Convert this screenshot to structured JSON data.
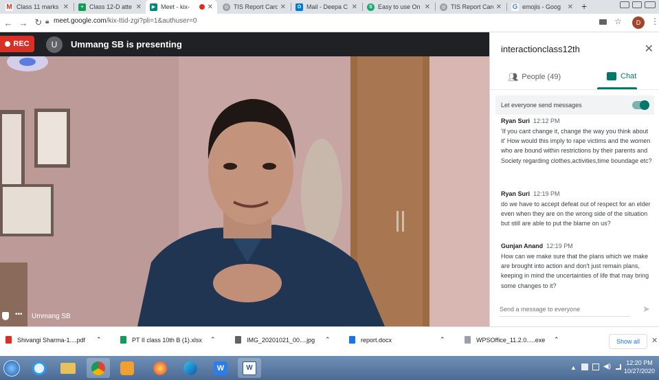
{
  "browser": {
    "tabs": [
      {
        "title": "Class 11 marks",
        "icon": "gmail-icon",
        "color": "#d93025"
      },
      {
        "title": "Class 12-D atte",
        "icon": "sheets-icon",
        "color": "#0f9d58"
      },
      {
        "title": "Meet - kix-",
        "icon": "meet-icon",
        "color": "#00897b",
        "active": true
      },
      {
        "title": "TIS Report Card",
        "icon": "globe-icon",
        "color": "#5f6368"
      },
      {
        "title": "Mail - Deepa C",
        "icon": "outlook-icon",
        "color": "#0078d4"
      },
      {
        "title": "Easy to use On",
        "icon": "s-icon",
        "color": "#1ba672"
      },
      {
        "title": "TIS Report Card",
        "icon": "globe-icon",
        "color": "#5f6368"
      },
      {
        "title": "emojis - Goog",
        "icon": "google-icon",
        "color": "#4285f4"
      }
    ],
    "new_tab": "+",
    "url_host": "meet.google.com",
    "url_path": "/kix-ttid-zgi?pli=1&authuser=0",
    "profile_letter": "D"
  },
  "meet": {
    "rec_label": "REC",
    "presenter_initial": "U",
    "presenting_text": "Ummang SB is presenting",
    "tile_name": "Ummang SB"
  },
  "panel": {
    "title": "interactionclass12th",
    "people_label": "People (49)",
    "chat_label": "Chat",
    "toggle_label": "Let everyone send messages",
    "messages": [
      {
        "author": "Ryan Suri",
        "time": "12:12 PM",
        "text": "'If you cant change it, change the way you think about it' How would this imply to rape victims and the women who are bound within restrictions by their parents and Society regarding clothes,activities,time boundage etc?"
      },
      {
        "author": "Ryan Suri",
        "time": "12:19 PM",
        "text": "do we have to accept defeat out of respect for an elder even when they are on the wrong side of the situation but still are able to put the blame on us?"
      },
      {
        "author": "Gunjan Anand",
        "time": "12:19 PM",
        "text": "How can we make sure that the plans which we make are brought into action and don't just remain plans, keeping in mind the uncertainties of life that may bring some changes to it?"
      }
    ],
    "compose_placeholder": "Send a message to everyone"
  },
  "downloads": {
    "items": [
      {
        "name": "Shivangi Sharma-1....pdf",
        "color": "#d93025"
      },
      {
        "name": "PT II class 10th B (1).xlsx",
        "color": "#0f9d58"
      },
      {
        "name": "IMG_20201021_00....jpg",
        "color": "#5f6368"
      },
      {
        "name": "report.docx",
        "color": "#1a73e8"
      },
      {
        "name": "WPSOffice_11.2.0.....exe",
        "color": "#5f6368"
      }
    ],
    "show_all": "Show all"
  },
  "taskbar": {
    "time": "12:20 PM",
    "date": "10/27/2020"
  }
}
